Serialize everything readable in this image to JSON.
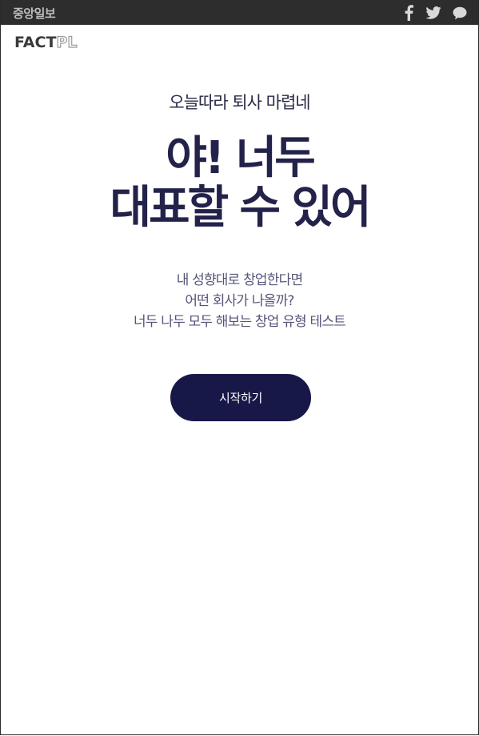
{
  "header": {
    "brand": "중앙일보",
    "share_icons": [
      "facebook-icon",
      "twitter-icon",
      "kakaotalk-icon"
    ]
  },
  "logo": {
    "part1": "FACT",
    "part2": "PL"
  },
  "hero": {
    "kicker": "오늘따라 퇴사 마렵네",
    "headline_line1": "야! 너두",
    "headline_line2": "대표할 수 있어",
    "description_line1": "내  성향대로 창업한다면",
    "description_line2": "어떤 회사가 나올까?",
    "description_line3": "너두 나두 모두 해보는 창업 유형 테스트"
  },
  "actions": {
    "start_label": "시작하기"
  },
  "colors": {
    "topbar_bg": "#2d2d2d",
    "headline": "#22224a",
    "button_bg": "#181848",
    "description": "#55557a"
  }
}
